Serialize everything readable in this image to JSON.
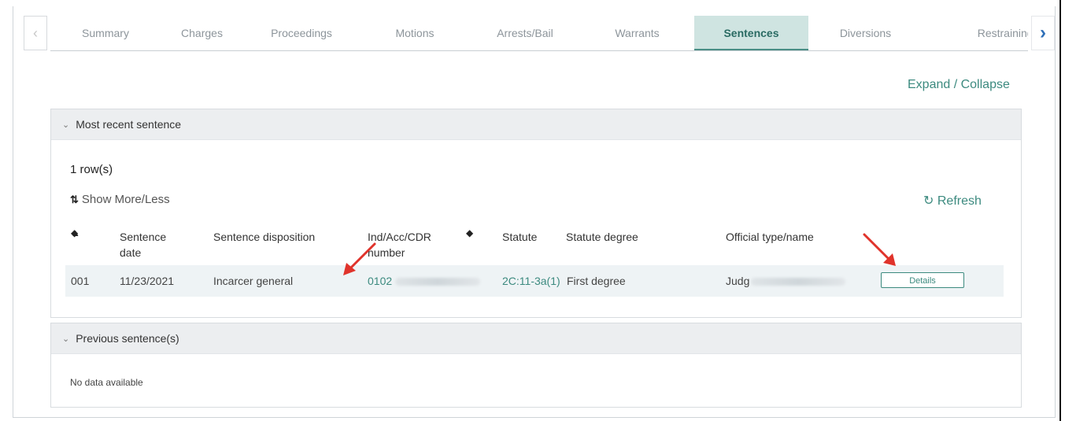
{
  "tabs": {
    "prev_icon": "chevron-left-icon",
    "next_icon": "chevron-right-icon",
    "items": [
      {
        "label": "Summary"
      },
      {
        "label": "Charges"
      },
      {
        "label": "Proceedings"
      },
      {
        "label": "Motions"
      },
      {
        "label": "Arrests/Bail"
      },
      {
        "label": "Warrants"
      },
      {
        "label": "Sentences",
        "active": true
      },
      {
        "label": "Diversions"
      },
      {
        "label": "Restraining Or"
      }
    ]
  },
  "expand_collapse": "Expand / Collapse",
  "recent": {
    "title": "Most recent sentence",
    "row_count": "1 row(s)",
    "show_more": "Show More/Less",
    "refresh": "Refresh",
    "columns": {
      "sentence_date": "Sentence date",
      "disposition": "Sentence disposition",
      "ind_acc": "Ind/Acc/CDR number",
      "statute": "Statute",
      "statute_degree": "Statute degree",
      "official": "Official type/name"
    },
    "row": {
      "seq": "001",
      "date": "11/23/2021",
      "disposition": "Incarcer general",
      "ind_acc_visible": "0102",
      "statute": "2C:11-3a(1)",
      "degree": "First degree",
      "official_visible": "Judg",
      "details": "Details"
    }
  },
  "previous": {
    "title": "Previous sentence(s)",
    "empty": "No data available"
  },
  "colors": {
    "accent": "#3c8a7f",
    "active_tab_bg": "#cfe4e1",
    "annotation_arrow": "#e0332b"
  }
}
